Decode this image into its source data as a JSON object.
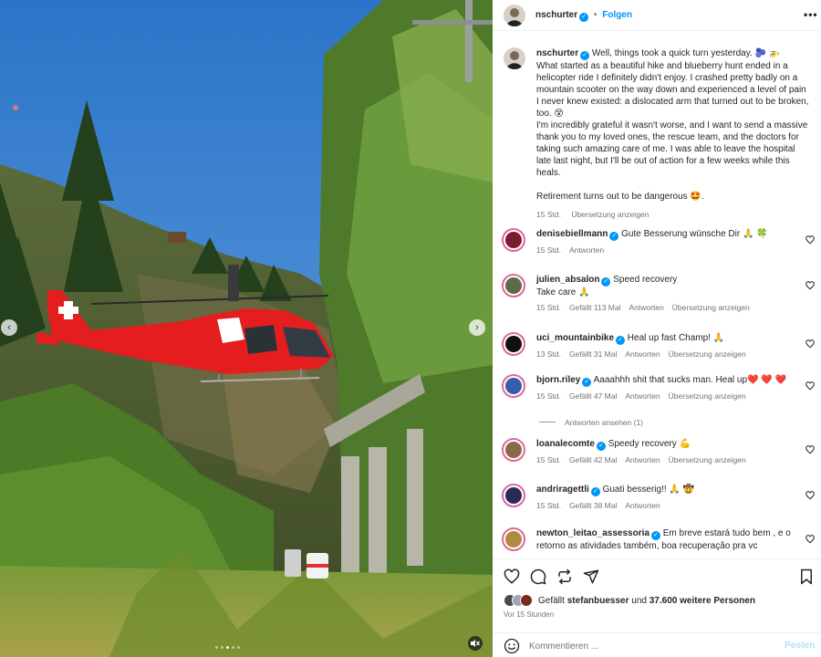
{
  "post": {
    "author": "nschurter",
    "follow_label": "Folgen",
    "more_label": "•••",
    "caption_lines": [
      "Well, things took a quick turn yesterday. 🫐 🚁",
      "What started as a beautiful hike and blueberry hunt ended in a helicopter ride I definitely didn't enjoy. I crashed pretty badly on a mountain scooter on the way down and experienced a level of pain I never knew existed: a dislocated arm that turned out to be broken, too. 😵",
      "I'm incredibly grateful it wasn't worse, and I want to send a massive thank you to my loved ones, the rescue team, and the doctors for taking such amazing care of me. I was able to leave the hospital late last night, but I'll be out of action for a few weeks while this heals.",
      "Retirement turns out to be dangerous 🤩."
    ],
    "caption_time": "15 Std.",
    "caption_translate": "Übersetzung anzeigen"
  },
  "comments": [
    {
      "user": "denisebiellmann",
      "text": "Gute Besserung wünsche Dir 🙏 🍀",
      "time": "15 Std.",
      "likes": "",
      "reply": "Antworten",
      "translate": "",
      "avatar_color": "#7a1b2e"
    },
    {
      "user": "julien_absalon",
      "text": "Speed recovery",
      "text2": "Take care 🙏",
      "time": "15 Std.",
      "likes": "Gefällt 113 Mal",
      "reply": "Antworten",
      "translate": "Übersetzung anzeigen",
      "avatar_color": "#5b6b4a"
    },
    {
      "user": "uci_mountainbike",
      "text": "Heal up fast Champ! 🙏",
      "time": "13 Std.",
      "likes": "Gefällt 31 Mal",
      "reply": "Antworten",
      "translate": "Übersetzung anzeigen",
      "avatar_color": "#111111"
    },
    {
      "user": "bjorn.riley",
      "text": "Aaaahhh shit that sucks man. Heal up❤️ ❤️ ❤️",
      "time": "15 Std.",
      "likes": "Gefällt 47 Mal",
      "reply": "Antworten",
      "translate": "Übersetzung anzeigen",
      "avatar_color": "#3a5ba8"
    },
    {
      "user": "loanalecomte",
      "text": "Speedy recovery 💪",
      "time": "15 Std.",
      "likes": "Gefällt 42 Mal",
      "reply": "Antworten",
      "translate": "Übersetzung anzeigen",
      "avatar_color": "#8a6a4a"
    },
    {
      "user": "andriragettli",
      "text": "Guati besserig!! 🙏 🤠",
      "time": "15 Std.",
      "likes": "Gefällt 38 Mal",
      "reply": "Antworten",
      "translate": "",
      "avatar_color": "#2a2a5a"
    },
    {
      "user": "newton_leitao_assessoria",
      "text": "Em breve estará tudo bem , e o retorno as atividades também, boa recuperação pra vc",
      "time": "",
      "likes": "",
      "reply": "",
      "translate": "",
      "avatar_color": "#b08a40"
    }
  ],
  "view_replies": "Antworten ansehen (1)",
  "likes": {
    "prefix": "Gefällt",
    "user": "stefanbuesser",
    "middle": "und",
    "count": "37.600 weitere Personen"
  },
  "time_ago": "Vor 15 Stunden",
  "comment_input": {
    "placeholder": "Kommentieren ...",
    "value": ""
  },
  "post_label": "Posten",
  "media": {
    "prev_arrow": "‹",
    "next_arrow": "›",
    "dot_count": 5,
    "active_dot": 2,
    "mute_icon": "speaker-muted-icon"
  },
  "colors": {
    "accent": "#0095f6",
    "post_disabled": "#b2dffc",
    "helicopter_red": "#e41e1e"
  }
}
